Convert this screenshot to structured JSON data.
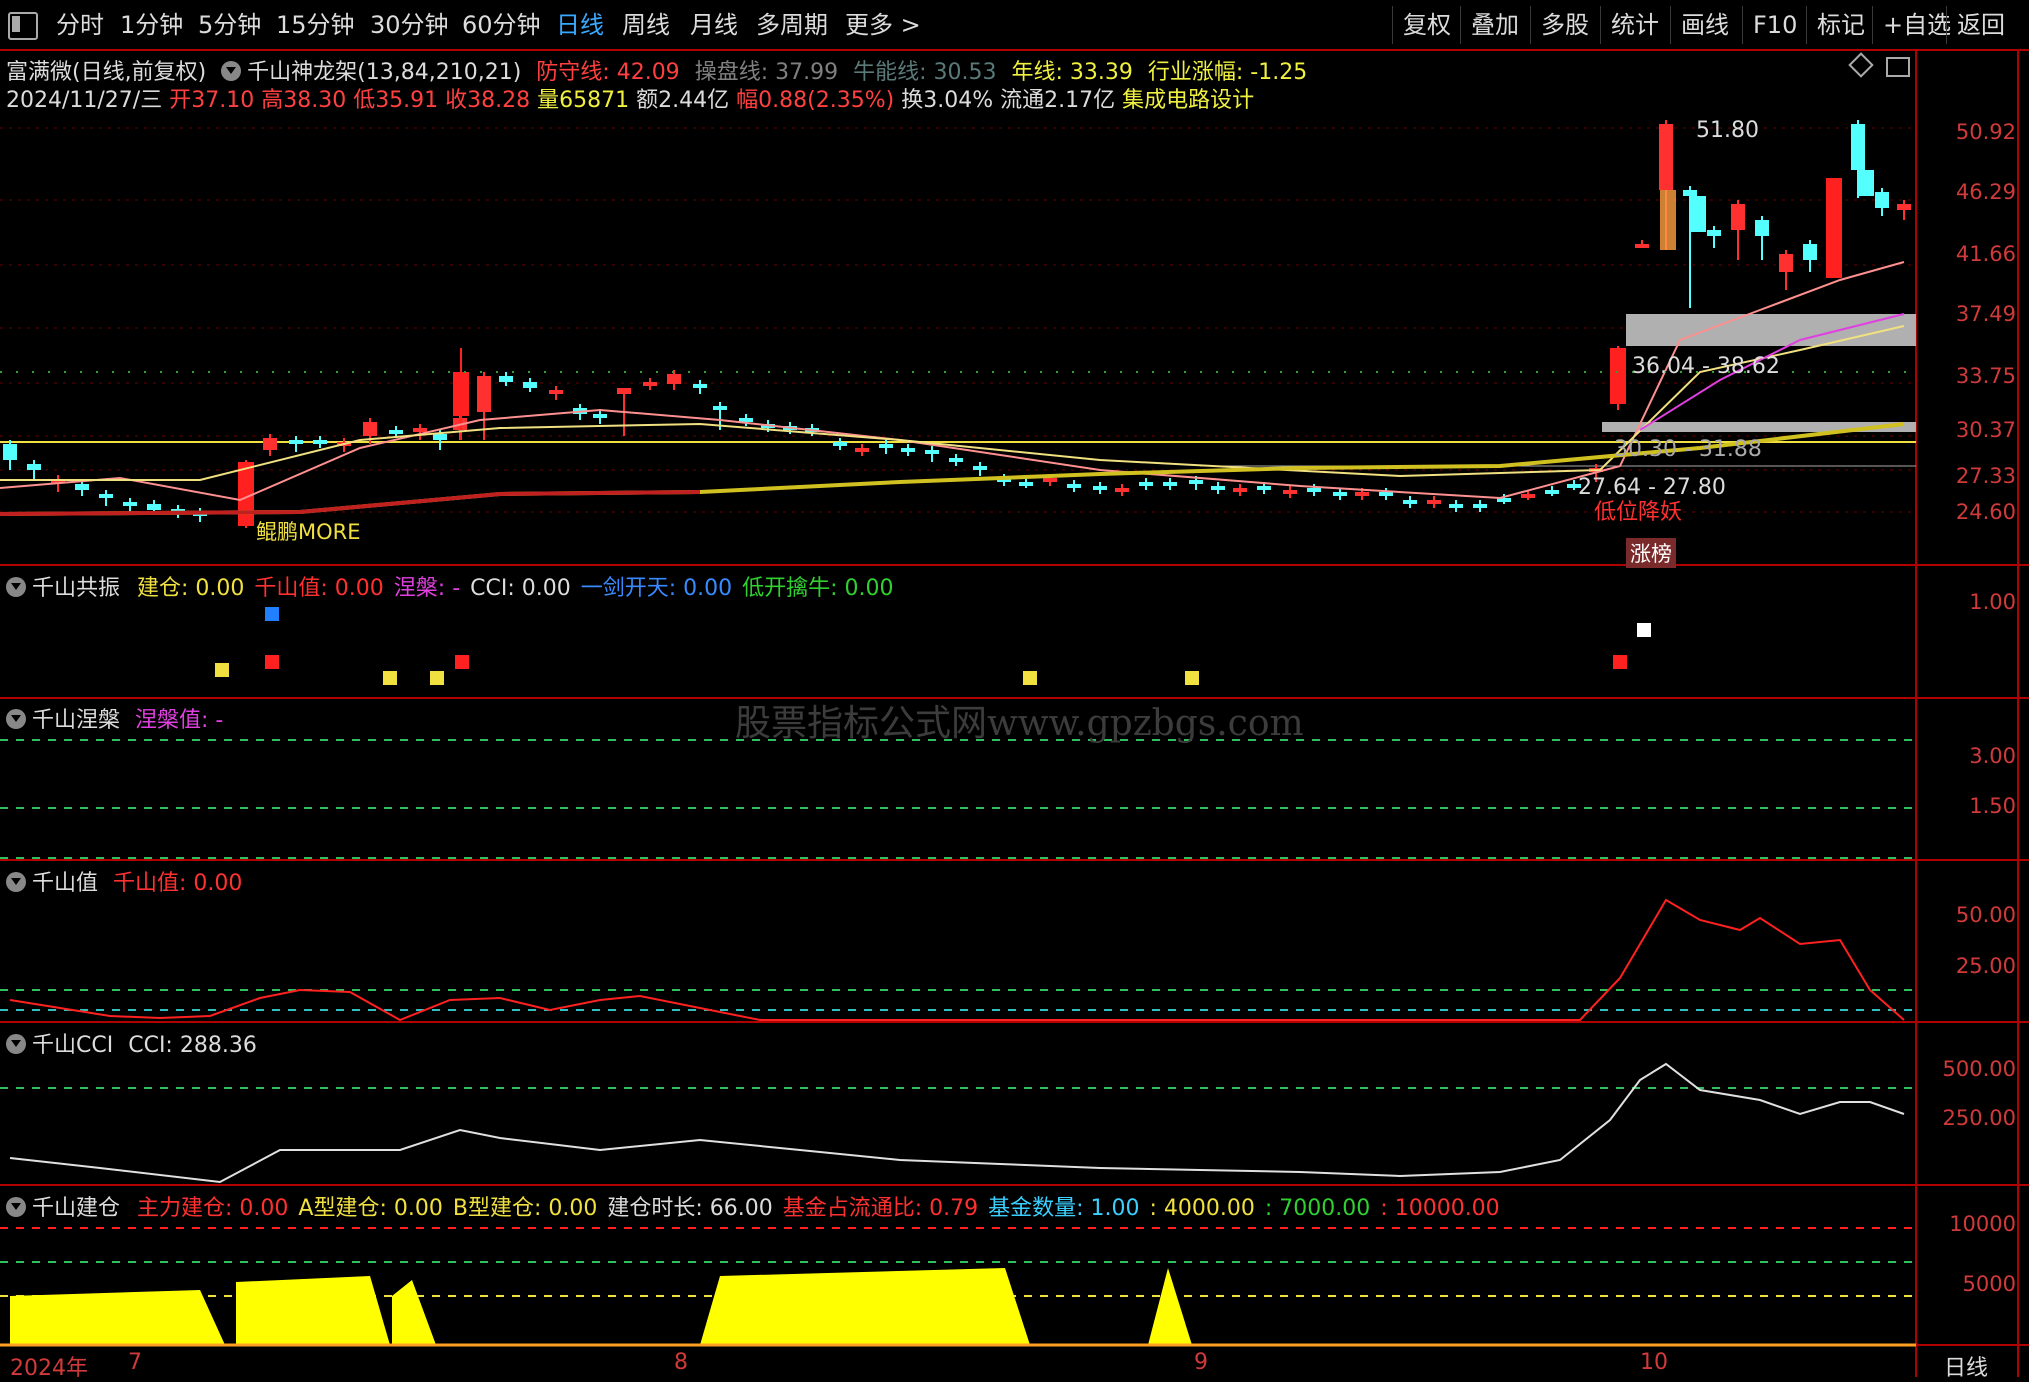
{
  "toolbar": {
    "periods": [
      "分时",
      "1分钟",
      "5分钟",
      "15分钟",
      "30分钟",
      "60分钟",
      "日线",
      "周线",
      "月线",
      "多周期",
      "更多 >"
    ],
    "active": "日线",
    "right": [
      "复权",
      "叠加",
      "多股",
      "统计",
      "画线",
      "F10",
      "标记",
      "+自选",
      "返回"
    ]
  },
  "header": {
    "stock": "富满微(日线,前复权)",
    "indicator": "千山神龙架(13,84,210,21)",
    "fangshou": "防守线: 42.09",
    "caopan": "操盘线: 37.99",
    "niuneng": "牛能线: 30.53",
    "nianxian": "年线: 33.39",
    "hangye": "行业涨幅: -1.25",
    "date": "2024/11/27/三",
    "open": "开37.10",
    "high": "高38.30",
    "low": "低35.91",
    "close": "收38.28",
    "vol": "量65871",
    "amount": "额2.44亿",
    "change": "幅0.88(2.35%)",
    "turnover": "换3.04%",
    "float": "流通2.17亿",
    "sector": "集成电路设计"
  },
  "main_axis": [
    "50.92",
    "46.29",
    "41.66",
    "37.49",
    "33.75",
    "30.37",
    "27.33",
    "24.60"
  ],
  "annotations": {
    "peak": "51.80",
    "zone1": "36.04 - 38.62",
    "zone2": "30.30 - 31.88",
    "zone3": "27.64 - 27.80",
    "low_signal": "低位降妖",
    "limit_up": "涨榜",
    "left_label": "鲲鹏MORE"
  },
  "pane1": {
    "title": "千山共振",
    "items": [
      {
        "label": "建仓: 0.00",
        "color": "#f0e040"
      },
      {
        "label": "千山值: 0.00",
        "color": "#ff3030"
      },
      {
        "label": "涅槃: -",
        "color": "#e040e0"
      },
      {
        "label": "CCI: 0.00",
        "color": "#dcdcdc"
      },
      {
        "label": "一剑开天: 0.00",
        "color": "#3a8aff"
      },
      {
        "label": "低开擒牛: 0.00",
        "color": "#30d030"
      }
    ],
    "axis": [
      "1.00"
    ]
  },
  "pane2": {
    "title": "千山涅槃",
    "value": "涅槃值: -",
    "axis": [
      "3.00",
      "1.50"
    ]
  },
  "pane3": {
    "title": "千山值",
    "value": "千山值: 0.00",
    "axis": [
      "50.00",
      "25.00"
    ]
  },
  "pane4": {
    "title": "千山CCI",
    "value": "CCI: 288.36",
    "axis": [
      "500.00",
      "250.00"
    ]
  },
  "pane5": {
    "title": "千山建仓",
    "items": [
      {
        "label": "主力建仓: 0.00",
        "color": "#ff3030"
      },
      {
        "label": "A型建仓: 0.00",
        "color": "#f0e040"
      },
      {
        "label": "B型建仓: 0.00",
        "color": "#f0e040"
      },
      {
        "label": "建仓时长: 66.00",
        "color": "#dcdcdc"
      },
      {
        "label": "基金占流通比: 0.79",
        "color": "#ff3030"
      },
      {
        "label": "基金数量: 1.00",
        "color": "#3ad0ff"
      },
      {
        "label": ": 4000.00",
        "color": "#f0e040"
      },
      {
        "label": ": 7000.00",
        "color": "#30d030"
      },
      {
        "label": ": 10000.00",
        "color": "#ff3030"
      }
    ],
    "axis": [
      "10000",
      "5000"
    ]
  },
  "watermark": "股票指标公式网www.gpzbgs.com",
  "xaxis": [
    "2024年",
    "7",
    "8",
    "9",
    "10"
  ],
  "period_label": "日线",
  "colors": {
    "up": "#ff3030",
    "down": "#54ffff",
    "bg": "#000000",
    "grid": "#b00000"
  }
}
